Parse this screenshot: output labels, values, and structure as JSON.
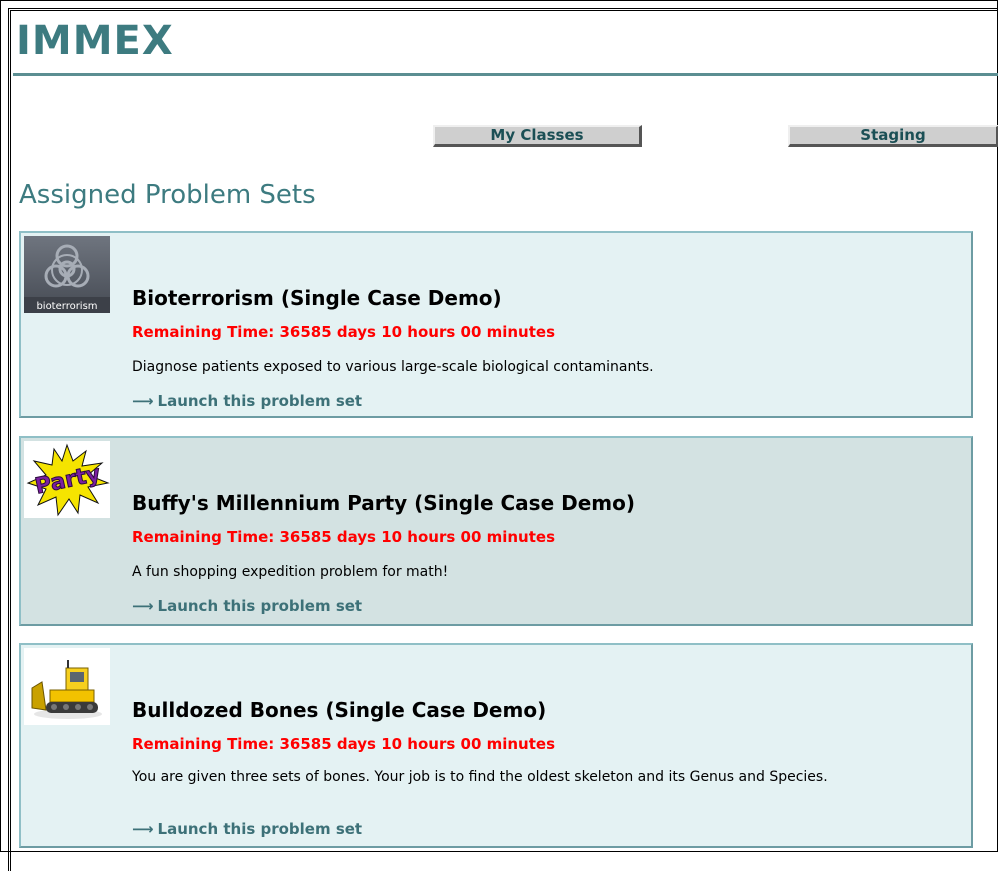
{
  "header": {
    "logo_text": "IMMEX"
  },
  "nav": {
    "my_classes_label": "My Classes",
    "staging_label": "Staging"
  },
  "main": {
    "section_title": "Assigned Problem Sets",
    "problem_sets": [
      {
        "thumbnail_label": "bioterrorism",
        "thumbnail_icon": "biohazard-icon",
        "title": "Bioterrorism (Single Case Demo)",
        "remaining_time": "Remaining Time: 36585 days 10 hours 00 minutes",
        "description": "Diagnose patients exposed to various large-scale biological contaminants.",
        "launch_label": "Launch this problem set",
        "launch_icon": "arrow-right-icon"
      },
      {
        "thumbnail_label": "Party",
        "thumbnail_icon": "party-logo",
        "title": "Buffy's Millennium Party (Single Case Demo)",
        "remaining_time": "Remaining Time: 36585 days 10 hours 00 minutes",
        "description": "A fun shopping expedition problem for math!",
        "launch_label": "Launch this problem set",
        "launch_icon": "arrow-right-icon"
      },
      {
        "thumbnail_icon": "bulldozer-icon",
        "title": "Bulldozed Bones (Single Case Demo)",
        "remaining_time": "Remaining Time: 36585 days 10 hours 00 minutes",
        "description": "You are given three sets of bones. Your job is to find the oldest skeleton and its Genus and Species.",
        "launch_label": "Launch this problem set",
        "launch_icon": "arrow-right-icon"
      }
    ]
  },
  "colors": {
    "brand_teal": "#3d7b80",
    "card_light": "#e4f2f3",
    "card_dark": "#d3e2e2",
    "alert_red": "#ff0000"
  }
}
